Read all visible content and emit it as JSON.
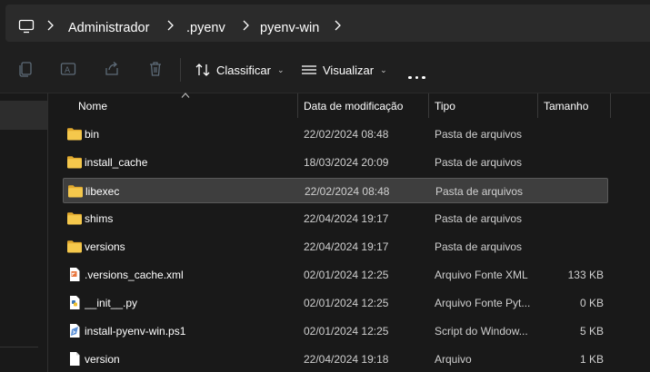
{
  "address_bar": {
    "breadcrumb": [
      "Administrador",
      ".pyenv",
      "pyenv-win"
    ]
  },
  "toolbar": {
    "sort_label": "Classificar",
    "view_label": "Visualizar"
  },
  "columns": {
    "name": "Nome",
    "date": "Data de modificação",
    "type": "Tipo",
    "size": "Tamanho"
  },
  "files": [
    {
      "name": "bin",
      "date": "22/02/2024 08:48",
      "type": "Pasta de arquivos",
      "size": "",
      "icon": "folder-icon"
    },
    {
      "name": "install_cache",
      "date": "18/03/2024 20:09",
      "type": "Pasta de arquivos",
      "size": "",
      "icon": "folder-icon"
    },
    {
      "name": "libexec",
      "date": "22/02/2024 08:48",
      "type": "Pasta de arquivos",
      "size": "",
      "icon": "folder-icon",
      "selected": true
    },
    {
      "name": "shims",
      "date": "22/04/2024 19:17",
      "type": "Pasta de arquivos",
      "size": "",
      "icon": "folder-icon"
    },
    {
      "name": "versions",
      "date": "22/04/2024 19:17",
      "type": "Pasta de arquivos",
      "size": "",
      "icon": "folder-icon"
    },
    {
      "name": ".versions_cache.xml",
      "date": "02/01/2024 12:25",
      "type": "Arquivo Fonte XML",
      "size": "133 KB",
      "icon": "xml-file-icon"
    },
    {
      "name": "__init__.py",
      "date": "02/01/2024 12:25",
      "type": "Arquivo Fonte Pyt...",
      "size": "0 KB",
      "icon": "python-file-icon"
    },
    {
      "name": "install-pyenv-win.ps1",
      "date": "02/01/2024 12:25",
      "type": "Script do Window...",
      "size": "5 KB",
      "icon": "powershell-file-icon"
    },
    {
      "name": "version",
      "date": "22/04/2024 19:18",
      "type": "Arquivo",
      "size": "1 KB",
      "icon": "file-icon"
    }
  ],
  "colors": {
    "background": "#191919",
    "toolbar": "#1f1f1f",
    "address_box": "#2b2b2b",
    "folder": "#f5c84c",
    "selected_row": "#3e3e3e"
  }
}
